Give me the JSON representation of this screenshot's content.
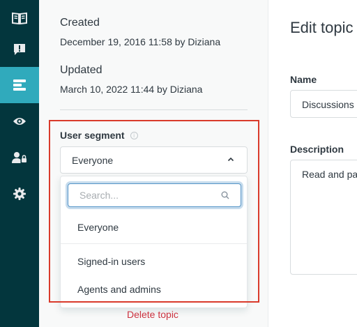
{
  "nav": {
    "items": [
      {
        "icon": "book-icon",
        "active": false
      },
      {
        "icon": "alert-message-icon",
        "active": false
      },
      {
        "icon": "topics-icon",
        "active": true
      },
      {
        "icon": "eye-icon",
        "active": false
      },
      {
        "icon": "user-lock-icon",
        "active": false
      },
      {
        "icon": "gear-icon",
        "active": false
      }
    ]
  },
  "meta": {
    "created_label": "Created",
    "created_value": "December 19, 2016 11:58 by Diziana",
    "updated_label": "Updated",
    "updated_value": "March 10, 2022 11:44 by Diziana"
  },
  "user_segment": {
    "label": "User segment",
    "info_glyph": "i",
    "selected": "Everyone",
    "search_placeholder": "Search...",
    "options": [
      "Everyone",
      "Signed-in users",
      "Agents and admins"
    ]
  },
  "delete_label": "Delete topic",
  "edit": {
    "title": "Edit topic",
    "name_label": "Name",
    "name_value": "Discussions",
    "description_label": "Description",
    "description_value": "Read and pa"
  },
  "colors": {
    "sidebar": "#03363d",
    "active_nav": "#30aabc",
    "highlight": "#d93a2b",
    "danger": "#cc3340"
  }
}
